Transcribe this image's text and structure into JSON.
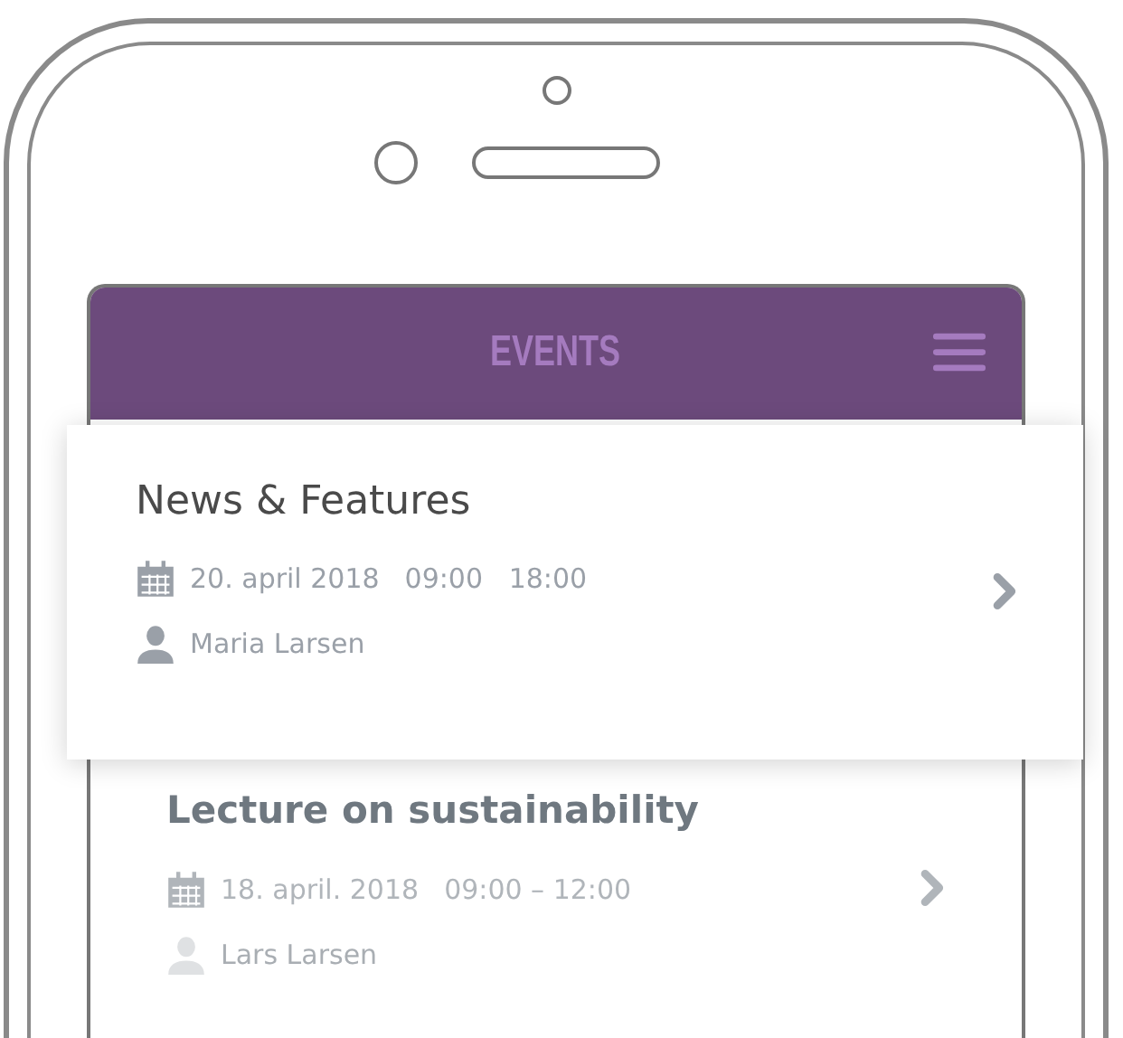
{
  "header": {
    "title": "EVENTS"
  },
  "events": [
    {
      "title": "News & Features",
      "date": "20. april 2018",
      "time": "09:00   18:00",
      "person": "Maria Larsen",
      "selected": true
    },
    {
      "title": "Lecture on sustainability",
      "date": "18. april. 2018",
      "time": "09:00 – 12:00",
      "person": "Lars Larsen",
      "selected": false
    }
  ]
}
